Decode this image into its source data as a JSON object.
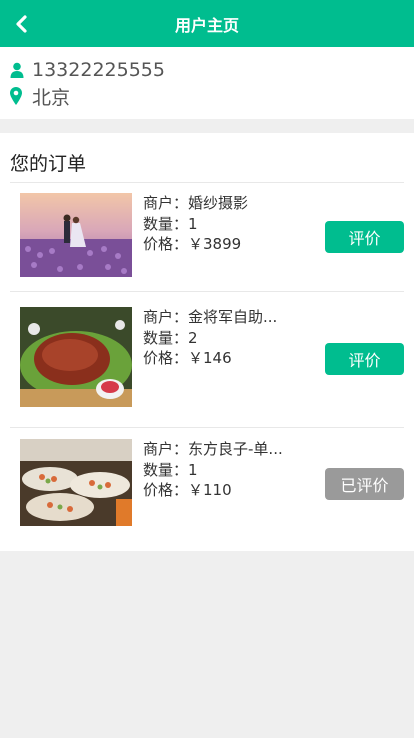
{
  "header": {
    "title": "用户主页",
    "back_icon": "chevron-left-icon"
  },
  "profile": {
    "phone": "13322225555",
    "city": "北京"
  },
  "orders": {
    "heading": "您的订单",
    "labels": {
      "merchant": "商户：",
      "quantity": "数量：",
      "price": "价格："
    },
    "items": [
      {
        "merchant": "婚纱摄影",
        "quantity": "1",
        "price": "￥3899",
        "action": "评价",
        "action_color": "#00bd8f"
      },
      {
        "merchant": "金将军自助...",
        "quantity": "2",
        "price": "￥146",
        "action": "评价",
        "action_color": "#00bd8f"
      },
      {
        "merchant": "东方良子-单...",
        "quantity": "1",
        "price": "￥110",
        "action": "已评价",
        "action_color": "#9a9a9a"
      }
    ]
  },
  "colors": {
    "accent": "#00bd8f",
    "disabled": "#9a9a9a",
    "background": "#efefef"
  }
}
